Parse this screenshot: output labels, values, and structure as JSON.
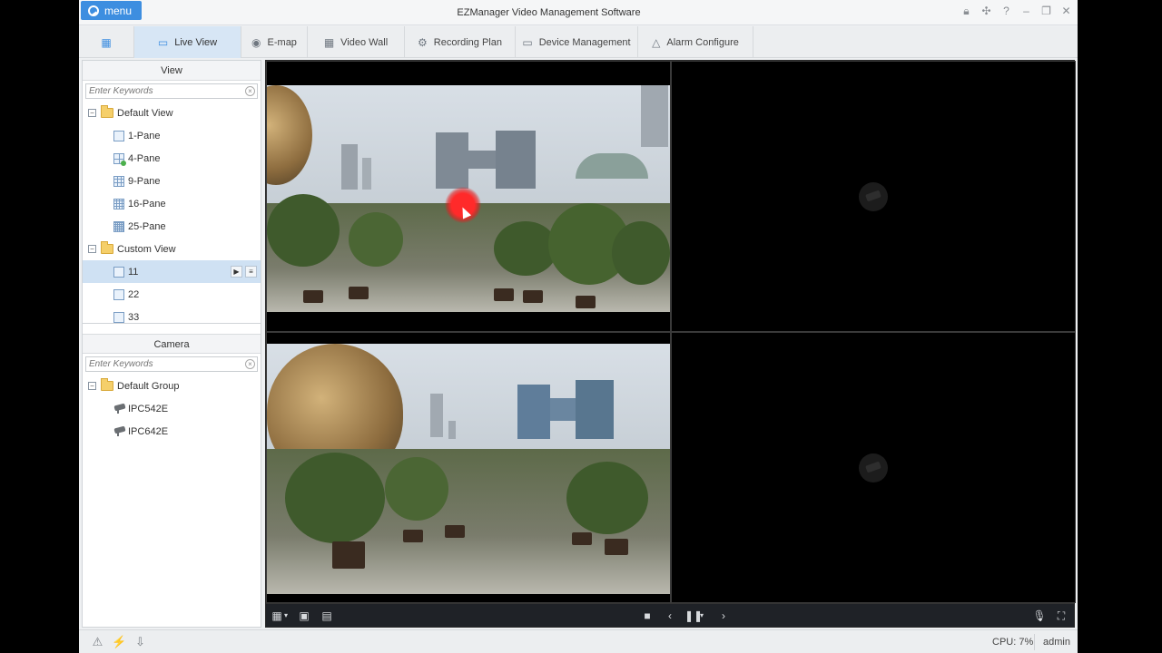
{
  "titlebar": {
    "menu_label": "menu",
    "app_title": "EZManager Video Management Software",
    "icons": [
      "lock-icon",
      "settings-icon",
      "help-icon",
      "minimize-icon",
      "restore-icon",
      "close-icon"
    ]
  },
  "tabs": [
    {
      "label": "Live View",
      "icon": "monitor-icon",
      "active": true
    },
    {
      "label": "E-map",
      "icon": "map-pin-icon"
    },
    {
      "label": "Video Wall",
      "icon": "video-wall-icon"
    },
    {
      "label": "Recording Plan",
      "icon": "gear-icon"
    },
    {
      "label": "Device Management",
      "icon": "device-icon"
    },
    {
      "label": "Alarm Configure",
      "icon": "alarm-icon"
    }
  ],
  "view_panel": {
    "title": "View",
    "search_placeholder": "Enter Keywords",
    "default_view": {
      "label": "Default View",
      "items": [
        "1-Pane",
        "4-Pane",
        "9-Pane",
        "16-Pane",
        "25-Pane"
      ]
    },
    "custom_view": {
      "label": "Custom View",
      "items": [
        "11",
        "22",
        "33"
      ],
      "selected": "11"
    }
  },
  "camera_panel": {
    "title": "Camera",
    "search_placeholder": "Enter Keywords",
    "group": {
      "label": "Default Group",
      "cameras": [
        "IPC542E",
        "IPC642E"
      ]
    }
  },
  "status": {
    "cpu": "CPU: 7%",
    "user": "admin"
  },
  "colors": {
    "accent": "#3d8ee0",
    "active_tab": "#d7e6f5",
    "selected_row": "#cfe1f3"
  }
}
